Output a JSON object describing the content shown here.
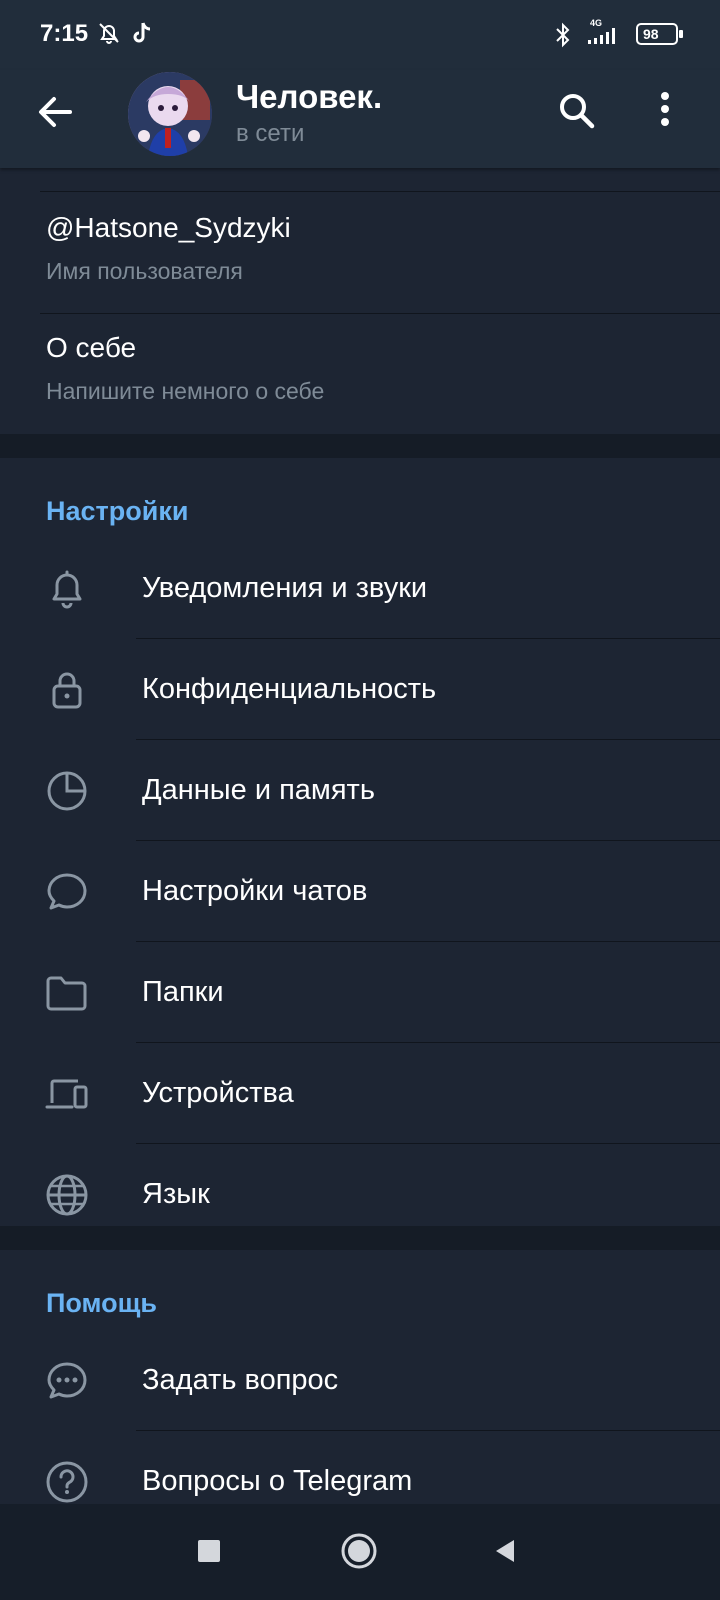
{
  "status_bar": {
    "time": "7:15",
    "left_icons": [
      "bell-off-icon",
      "tiktok-icon"
    ],
    "right_icons": [
      "bluetooth-icon",
      "signal-4g-icon",
      "battery-icon"
    ],
    "network": "4G",
    "battery": "98"
  },
  "header": {
    "title": "Человек.",
    "subtitle": "в сети"
  },
  "profile": {
    "username": "@Hatsone_Sydzyki",
    "username_label": "Имя пользователя",
    "bio": "О себе",
    "bio_hint": "Напишите немного о себе"
  },
  "settings": {
    "title": "Настройки",
    "items": [
      {
        "label": "Уведомления и звуки",
        "icon": "bell-icon"
      },
      {
        "label": "Конфиденциальность",
        "icon": "lock-icon"
      },
      {
        "label": "Данные и память",
        "icon": "pie-chart-icon"
      },
      {
        "label": "Настройки чатов",
        "icon": "chat-bubble-icon"
      },
      {
        "label": "Папки",
        "icon": "folder-icon"
      },
      {
        "label": "Устройства",
        "icon": "devices-icon"
      },
      {
        "label": "Язык",
        "icon": "globe-icon"
      }
    ]
  },
  "help": {
    "title": "Помощь",
    "items": [
      {
        "label": "Задать вопрос",
        "icon": "chat-dots-icon"
      },
      {
        "label": "Вопросы о Telegram",
        "icon": "question-icon"
      }
    ]
  },
  "colors": {
    "background": "#1d2533",
    "header": "#212d3b",
    "accent": "#6ab3f3",
    "secondary_text": "#7f8b97"
  }
}
